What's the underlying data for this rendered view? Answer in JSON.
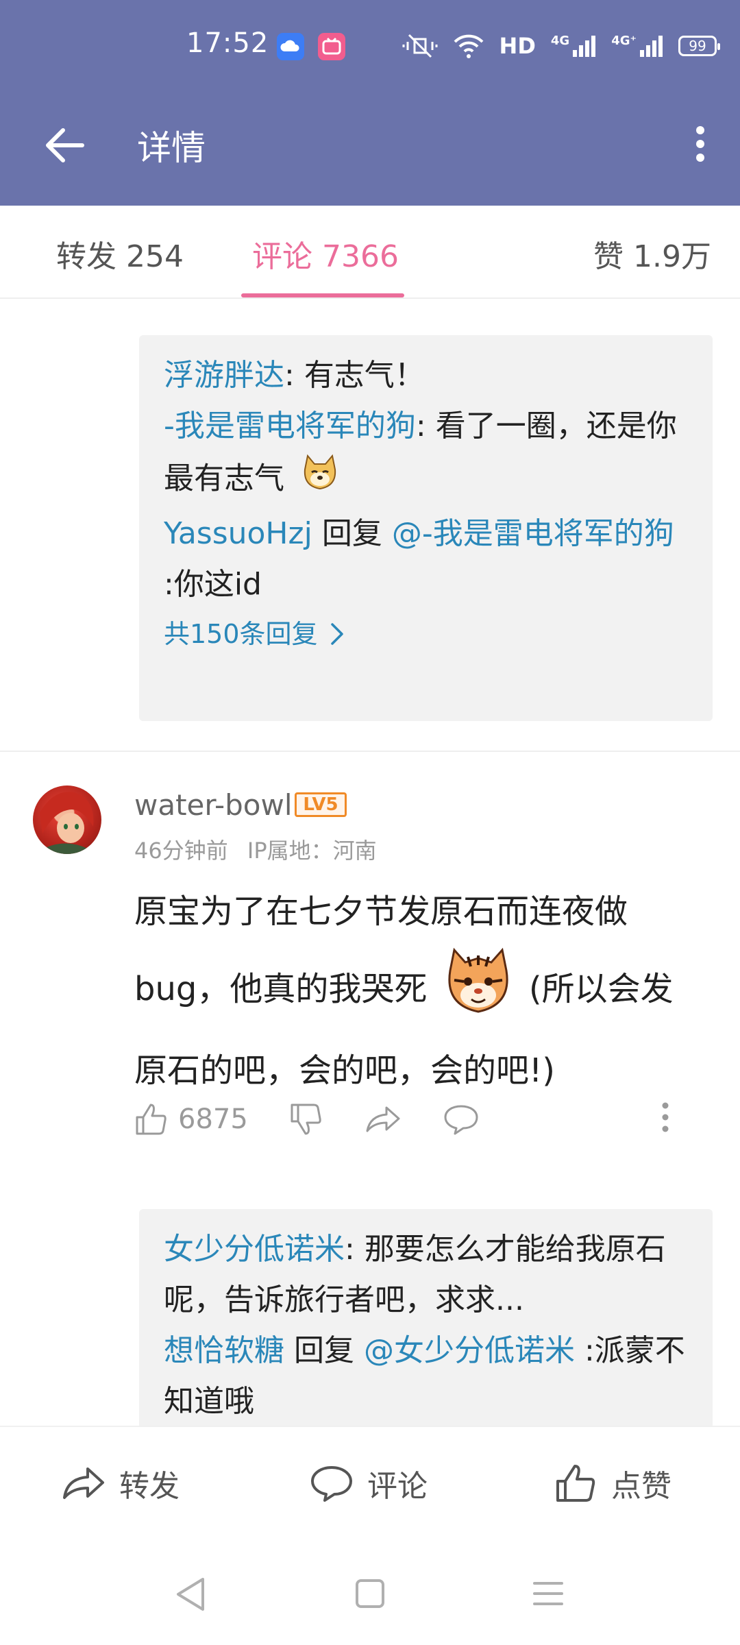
{
  "status_bar": {
    "time": "17:52",
    "network_label": "HD",
    "signal_1": "4G",
    "signal_2": "4G⁺",
    "battery": "99",
    "icons": [
      "cloud-app-icon",
      "bilibili-icon",
      "mute-vibrate-icon",
      "wifi-icon"
    ]
  },
  "app_bar": {
    "title": "详情",
    "back_icon": "arrow-left-icon",
    "more_icon": "more-vertical-icon"
  },
  "tabs": [
    {
      "label": "转发 254",
      "active": false
    },
    {
      "label": "评论 7366",
      "active": true
    },
    {
      "label": "赞 1.9万",
      "active": false
    }
  ],
  "thread1": {
    "replies": [
      {
        "user": "浮游胖达",
        "sep": ": ",
        "text": "有志气！"
      },
      {
        "user": "-我是雷电将军的狗",
        "sep": ": ",
        "text": "看了一圈，还是你最有志气"
      },
      {
        "user": "YassuoHzj",
        "mid": " 回复 ",
        "target": "@-我是雷电将军的狗",
        "text": " :你这id"
      }
    ],
    "more": "共150条回复"
  },
  "comment": {
    "user": "water-bowl",
    "level": "LV5",
    "time": "46分钟前",
    "ip": "IP属地：河南",
    "text_part1": "原宝为了在七夕节发原石而连夜做bug，他真的我哭死",
    "text_part2": "(所以会发原石的吧，会的吧，会的吧!)",
    "likes": "6875"
  },
  "thread2": {
    "replies": [
      {
        "user": "女少分低诺米",
        "sep": ": ",
        "text": "那要怎么才能给我原石呢，告诉旅行者吧，求求..."
      },
      {
        "user": "想恰软糖",
        "mid": " 回复 ",
        "target": "@女少分低诺米",
        "text": " :派蒙不知道哦"
      }
    ]
  },
  "bottom_bar": {
    "forward": "转发",
    "comment": "评论",
    "like": "点赞"
  },
  "colors": {
    "header": "#6a73ab",
    "accent_pink": "#eb6d9a",
    "link_blue": "#2a87b9",
    "level_orange": "#f08a27"
  }
}
